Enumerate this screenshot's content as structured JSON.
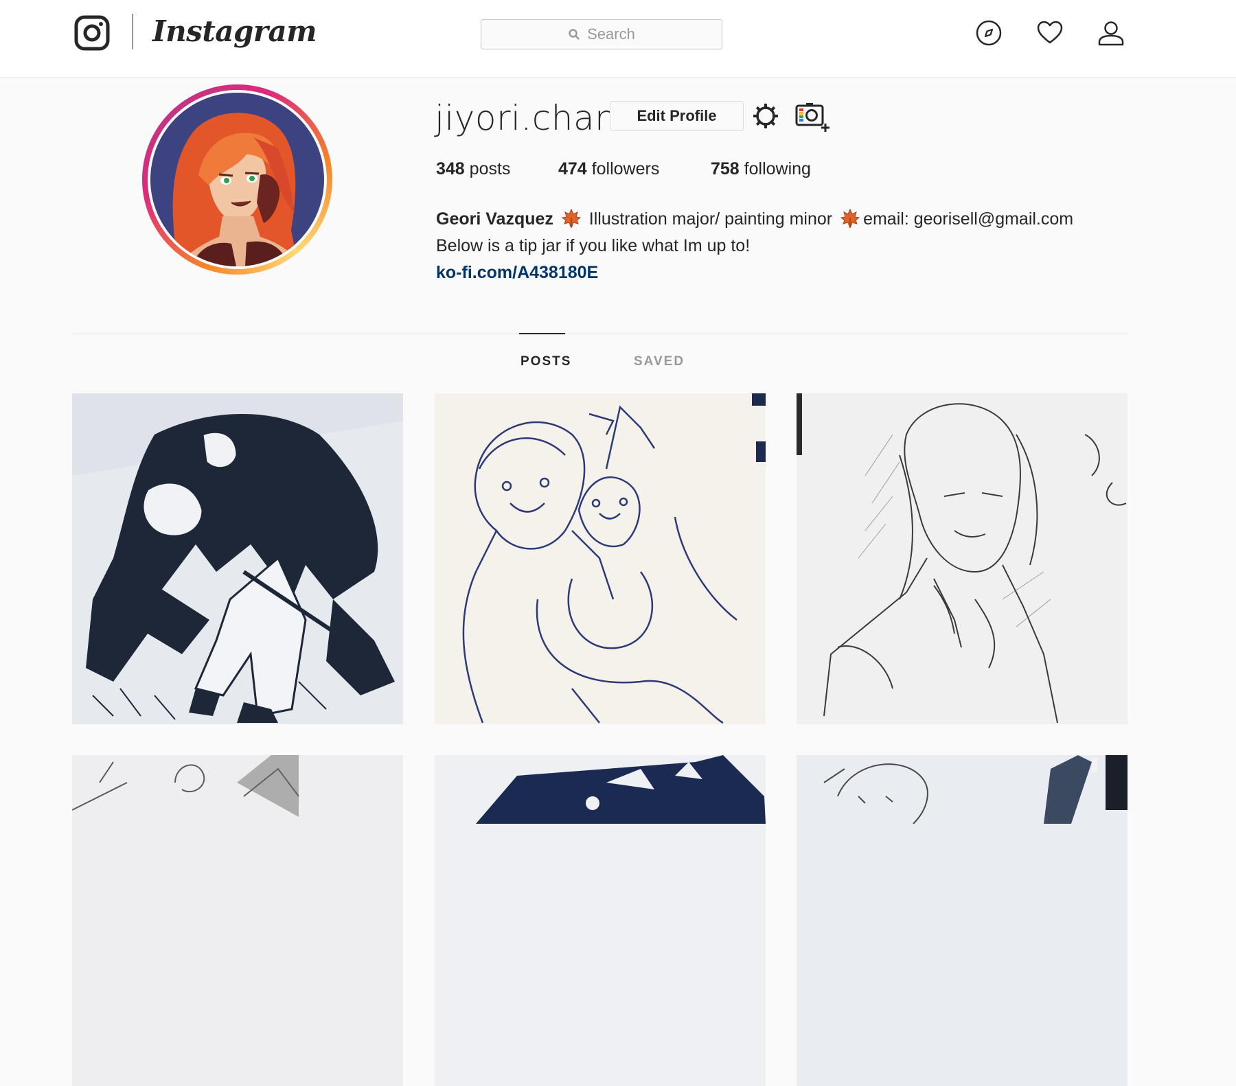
{
  "header": {
    "brand": "Instagram",
    "search_placeholder": "Search",
    "icons": [
      "instagram-camera-icon",
      "search-icon",
      "compass-icon",
      "heart-icon",
      "profile-icon"
    ]
  },
  "profile": {
    "username": "jiyori.chan",
    "edit_label": "Edit Profile",
    "stats": {
      "posts_count": "348",
      "posts_label": "posts",
      "followers_count": "474",
      "followers_label": "followers",
      "following_count": "758",
      "following_label": "following"
    },
    "bio": {
      "name": "Geori Vazquez",
      "line1_a": "Illustration major/ painting minor",
      "line1_b": "email: georisell@gmail.com",
      "line2": "Below is a tip jar if you like what Im up to!",
      "link": "ko-fi.com/A438180E"
    }
  },
  "tabs": [
    {
      "label": "POSTS",
      "active": true
    },
    {
      "label": "SAVED",
      "active": false
    }
  ],
  "colors": {
    "accent_link": "#003569",
    "ring_gradient": [
      "#f58529",
      "#dd2a7b",
      "#c13584",
      "#feda77"
    ],
    "ink_blue": "#1b2a4a"
  },
  "posts_visible": 6
}
